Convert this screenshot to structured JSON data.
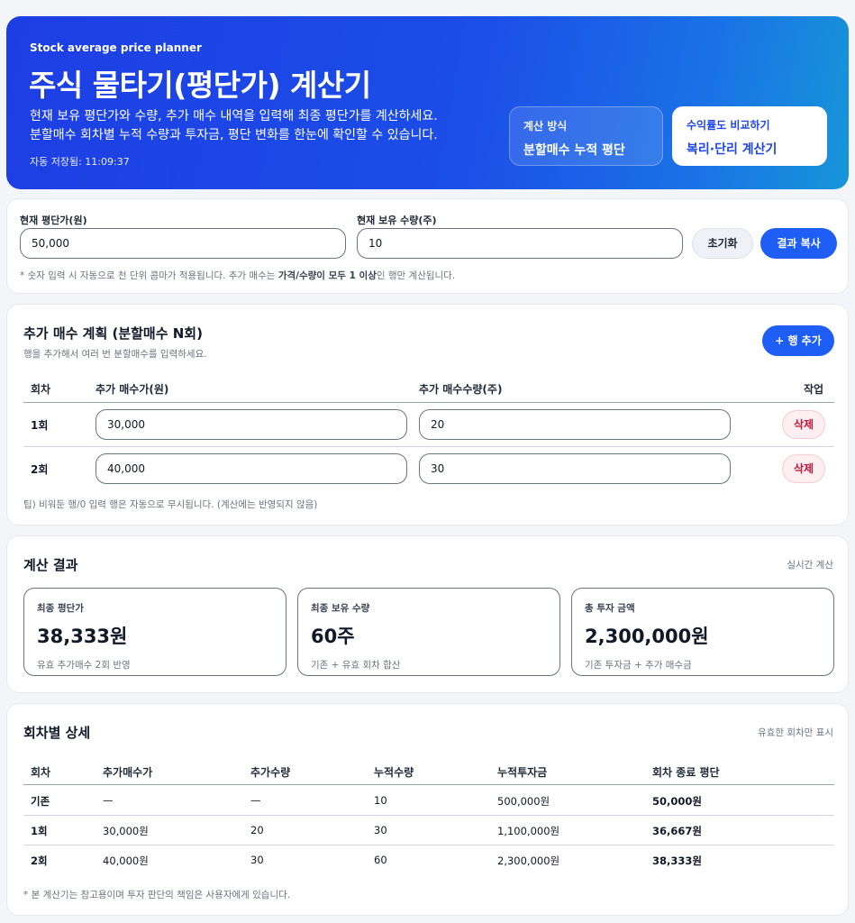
{
  "hero": {
    "kicker": "Stock average price planner",
    "title": "주식 물타기(평단가) 계산기",
    "desc1": "현재 보유 평단가와 수량, 추가 매수 내역을 입력해 최종 평단가를 계산하세요.",
    "desc2": "분할매수 회차별 누적 수량과 투자금, 평단 변화를 한눈에 확인할 수 있습니다.",
    "saved": "자동 저장됨: 11:09:37",
    "method_title": "계산 방식",
    "method_value": "분할매수 누적 평단",
    "compare_title": "수익률도 비교하기",
    "compare_value": "복리·단리 계산기"
  },
  "inputs": {
    "avg_label": "현재 평단가(원)",
    "avg_value": "50,000",
    "qty_label": "현재 보유 수량(주)",
    "qty_value": "10",
    "reset_label": "초기화",
    "copy_label": "결과 복사",
    "note_pre": "* 숫자 입력 시 자동으로 천 단위 콤마가 적용됩니다. 추가 매수는 ",
    "note_bold": "가격/수량이 모두 1 이상",
    "note_post": "인 행만 계산됩니다."
  },
  "plan": {
    "title": "추가 매수 계획 (분할매수 N회)",
    "subtitle": "행을 추가해서 여러 번 분할매수를 입력하세요.",
    "add_label": "+ 행 추가",
    "headers": [
      "회차",
      "추가 매수가(원)",
      "추가 매수수량(주)",
      "작업"
    ],
    "rows": [
      {
        "round": "1회",
        "price": "30,000",
        "qty": "20",
        "action": "삭제"
      },
      {
        "round": "2회",
        "price": "40,000",
        "qty": "30",
        "action": "삭제"
      }
    ],
    "tip": "팁) 비워둔 행/0 입력 행은 자동으로 무시됩니다. (계산에는 반영되지 않음)"
  },
  "result": {
    "title": "계산 결과",
    "right_note": "실시간 계산",
    "cards": [
      {
        "title": "최종 평단가",
        "value": "38,333원",
        "sub": "유효 추가매수 2회 반영"
      },
      {
        "title": "최종 보유 수량",
        "value": "60주",
        "sub": "기존 + 유효 회차 합산"
      },
      {
        "title": "총 투자 금액",
        "value": "2,300,000원",
        "sub": "기존 투자금 + 추가 매수금"
      }
    ]
  },
  "detail": {
    "title": "회차별 상세",
    "right_note": "유효한 회차만 표시",
    "headers": [
      "회차",
      "추가매수가",
      "추가수량",
      "누적수량",
      "누적투자금",
      "회차 종료 평단"
    ],
    "rows": [
      [
        "기존",
        "—",
        "—",
        "10",
        "500,000원",
        "50,000원"
      ],
      [
        "1회",
        "30,000원",
        "20",
        "30",
        "1,100,000원",
        "36,667원"
      ],
      [
        "2회",
        "40,000원",
        "30",
        "60",
        "2,300,000원",
        "38,333원"
      ]
    ],
    "footnote": "* 본 계산기는 참고용이며 투자 판단의 책임은 사용자에게 있습니다."
  }
}
